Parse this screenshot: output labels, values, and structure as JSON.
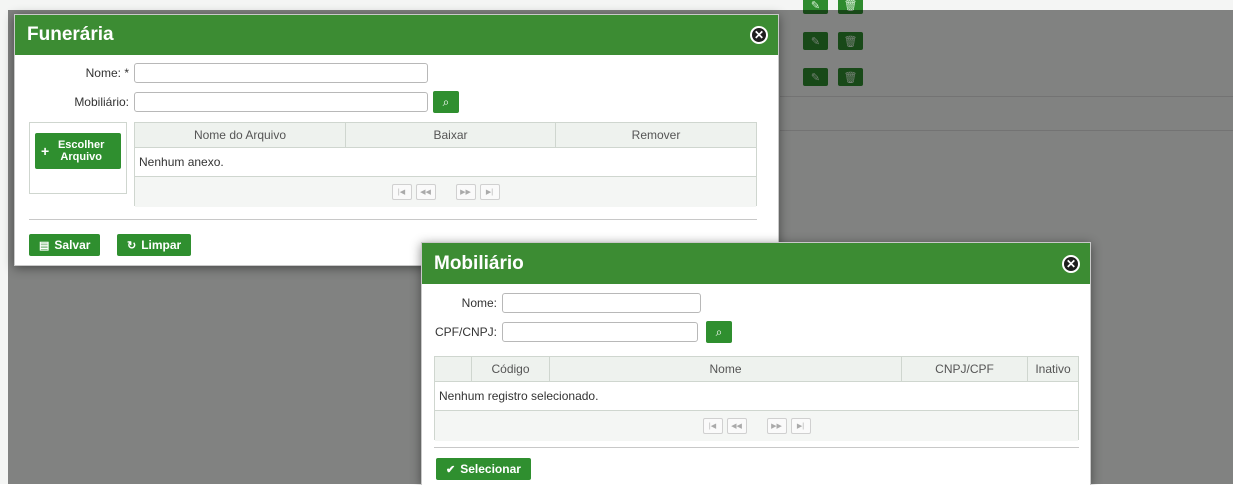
{
  "funeraria": {
    "title": "Funerária",
    "name_label": "Nome: *",
    "mobiliario_label": "Mobiliário:",
    "choose_file_label": "Escolher Arquivo",
    "columns": [
      "Nome do Arquivo",
      "Baixar",
      "Remover"
    ],
    "empty_text": "Nenhum anexo.",
    "save_label": "Salvar",
    "clear_label": "Limpar"
  },
  "mobiliario": {
    "title": "Mobiliário",
    "name_label": "Nome:",
    "cpf_label": "CPF/CNPJ:",
    "columns": [
      "",
      "Código",
      "Nome",
      "CNPJ/CPF",
      "Inativo"
    ],
    "empty_text": "Nenhum registro selecionado.",
    "select_label": "Selecionar"
  },
  "colors": {
    "accent": "#3c8c33",
    "button": "#2f8f2f"
  }
}
